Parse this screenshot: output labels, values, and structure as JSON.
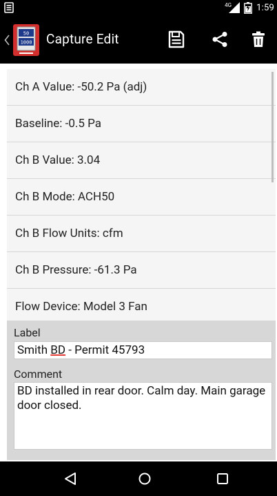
{
  "status_bar": {
    "network_label": "4G",
    "time": "1:59"
  },
  "action_bar": {
    "title": "Capture Edit",
    "app_icon_values": [
      "50",
      "1000"
    ],
    "buttons": [
      "save-icon",
      "share-icon",
      "delete-icon"
    ]
  },
  "list": {
    "items": [
      {
        "label": "Ch A Value: -50.2 Pa (adj)"
      },
      {
        "label": "Baseline: -0.5 Pa"
      },
      {
        "label": "Ch B Value: 3.04"
      },
      {
        "label": "Ch B Mode: ACH50"
      },
      {
        "label": "Ch B Flow Units: cfm"
      },
      {
        "label": "Ch B Pressure: -61.3 Pa"
      },
      {
        "label": "Flow Device: Model 3 Fan"
      }
    ]
  },
  "form": {
    "label_title": "Label",
    "label_value_prefix": "Smith ",
    "label_value_highlight": "BD",
    "label_value_suffix": " - Permit 45793",
    "comment_title": "Comment",
    "comment_value": "BD installed in rear door. Calm day. Main garage door closed."
  },
  "colors": {
    "bar_bg": "#000000",
    "list_bg": "#f5f5f5",
    "panel_bg": "#d7d7d7",
    "spell_underline": "#e53935",
    "app_icon_red": "#d32f2f"
  },
  "nav_bar": {
    "buttons": [
      "back-icon",
      "home-icon",
      "recents-icon"
    ]
  }
}
